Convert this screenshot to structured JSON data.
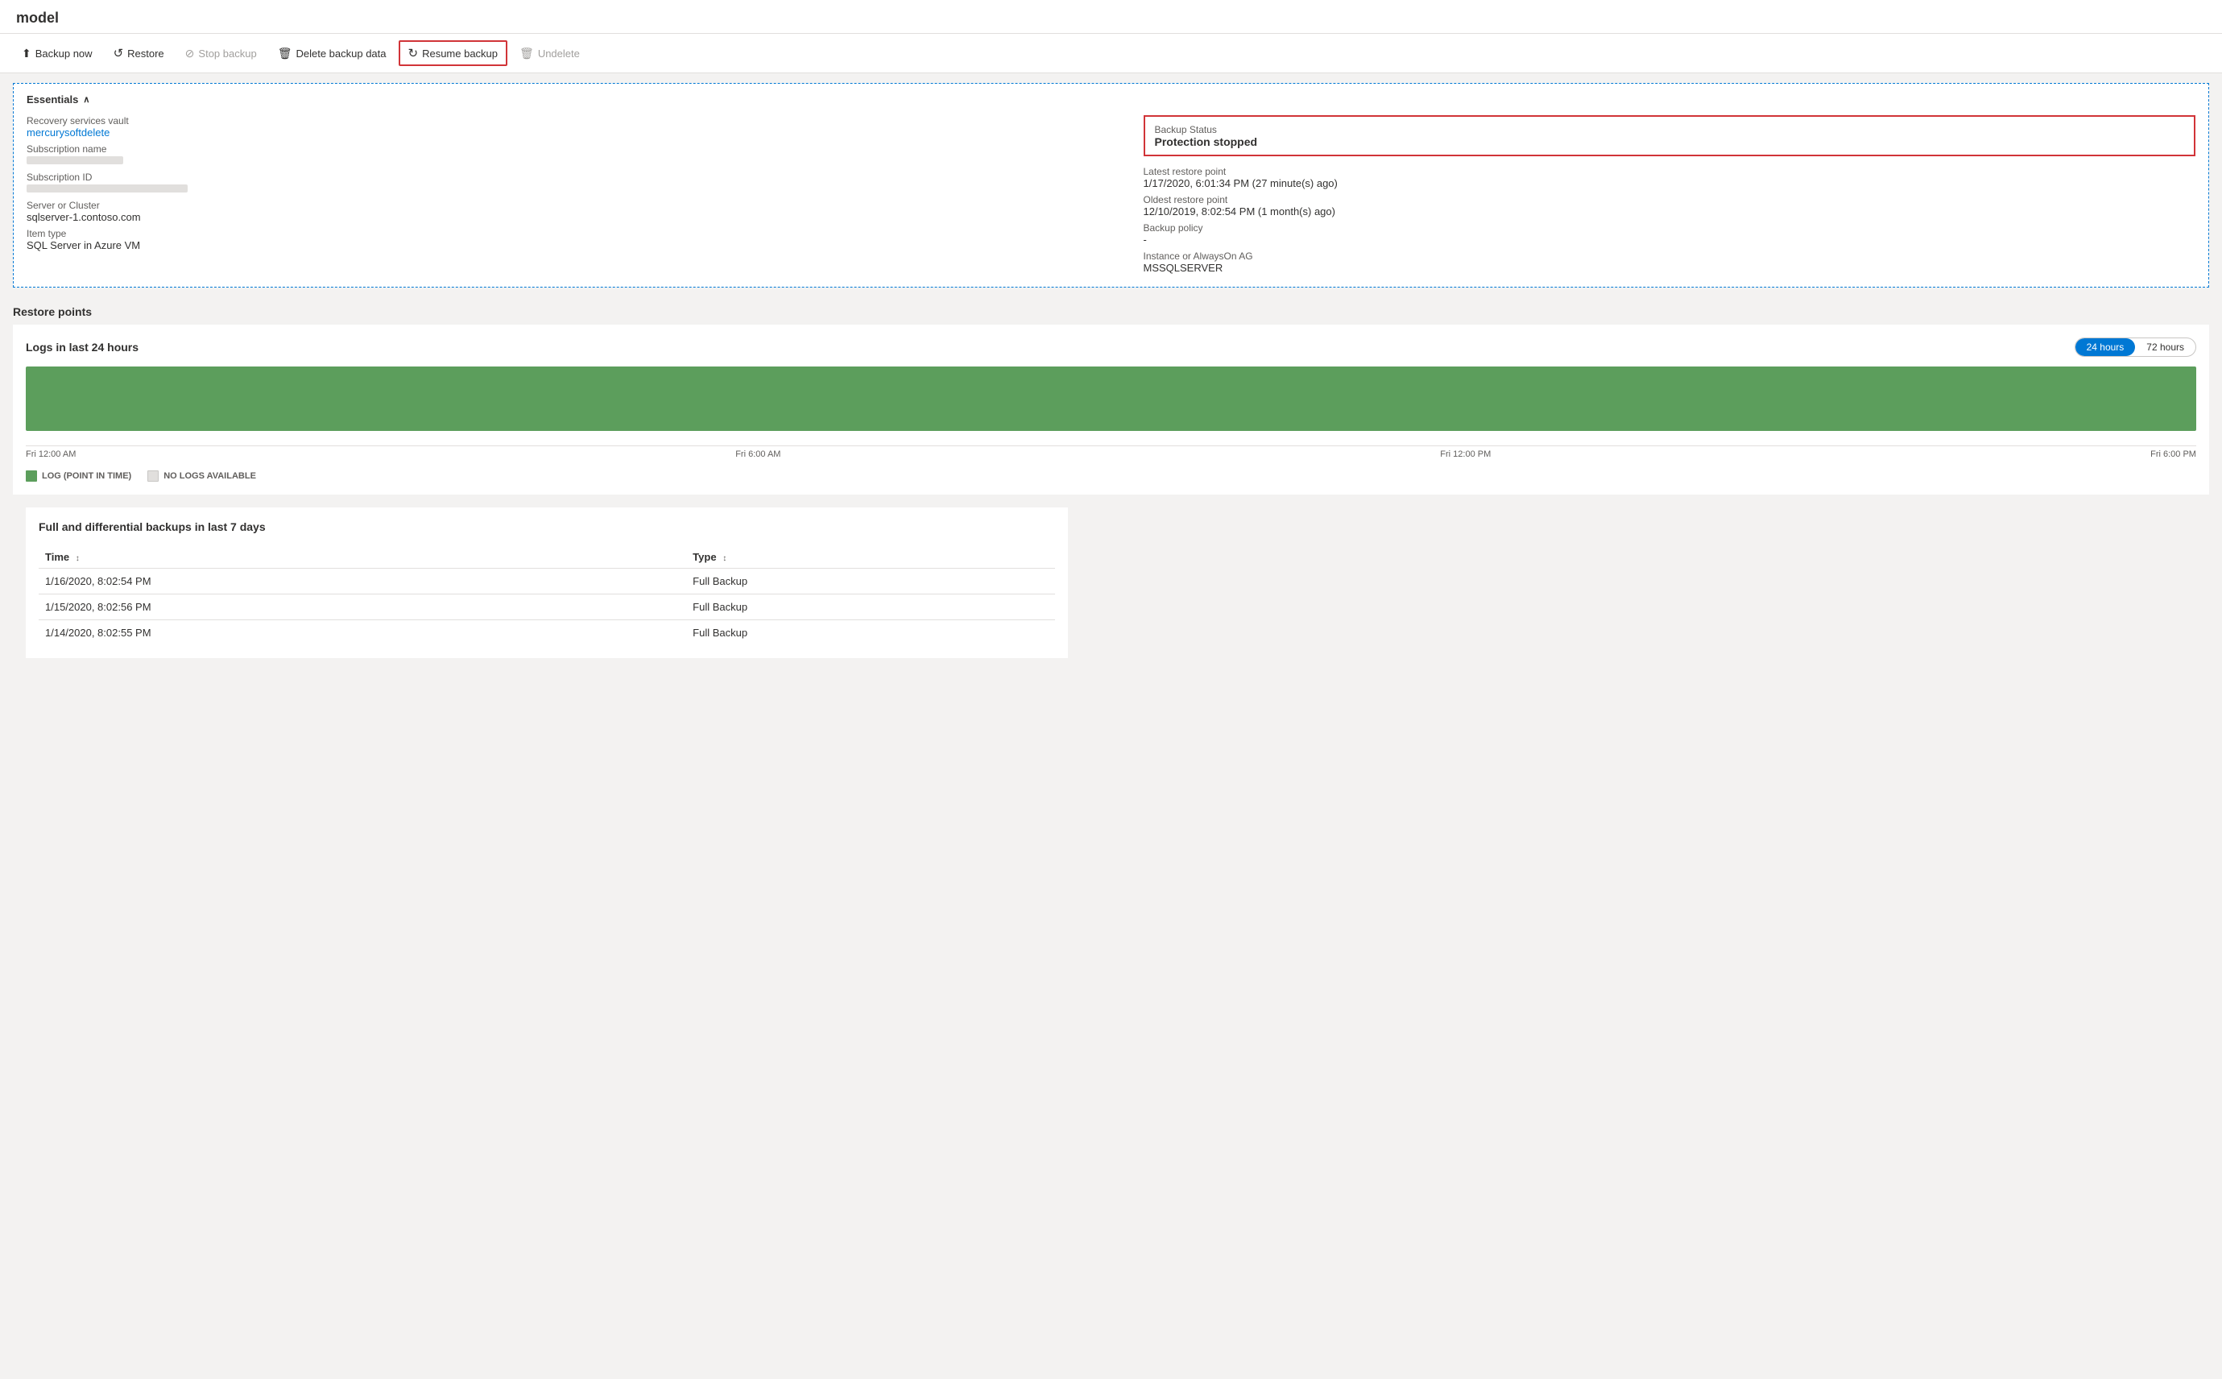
{
  "page": {
    "title": "model"
  },
  "toolbar": {
    "buttons": [
      {
        "id": "backup-now",
        "label": "Backup now",
        "icon": "⬆",
        "disabled": false,
        "highlighted": false
      },
      {
        "id": "restore",
        "label": "Restore",
        "icon": "↺",
        "disabled": false,
        "highlighted": false
      },
      {
        "id": "stop-backup",
        "label": "Stop backup",
        "icon": "⊘",
        "disabled": true,
        "highlighted": false
      },
      {
        "id": "delete-backup-data",
        "label": "Delete backup data",
        "icon": "🗑",
        "disabled": false,
        "highlighted": false
      },
      {
        "id": "resume-backup",
        "label": "Resume backup",
        "icon": "↻",
        "disabled": false,
        "highlighted": true
      },
      {
        "id": "undelete",
        "label": "Undelete",
        "icon": "🗑",
        "disabled": true,
        "highlighted": false
      }
    ]
  },
  "essentials": {
    "header": "Essentials",
    "fields_left": [
      {
        "id": "recovery-vault",
        "label": "Recovery services vault",
        "value": "mercurysoftdelete",
        "is_link": true
      },
      {
        "id": "subscription-name",
        "label": "Subscription name",
        "value": ""
      },
      {
        "id": "subscription-id",
        "label": "Subscription ID",
        "value": ""
      },
      {
        "id": "server-cluster",
        "label": "Server or Cluster",
        "value": "sqlserver-1.contoso.com"
      },
      {
        "id": "item-type",
        "label": "Item type",
        "value": "SQL Server in Azure VM"
      }
    ],
    "fields_right": [
      {
        "id": "backup-status-label",
        "label": "Backup Status",
        "value": "Protection stopped",
        "highlighted": true
      },
      {
        "id": "latest-restore-label",
        "label": "Latest restore point",
        "value": ""
      },
      {
        "id": "latest-restore-value",
        "label": "",
        "value": "1/17/2020, 6:01:34 PM (27 minute(s) ago)"
      },
      {
        "id": "oldest-restore-label",
        "label": "Oldest restore point",
        "value": ""
      },
      {
        "id": "oldest-restore-value",
        "label": "",
        "value": "12/10/2019, 8:02:54 PM (1 month(s) ago)"
      },
      {
        "id": "backup-policy-label",
        "label": "Backup policy",
        "value": ""
      },
      {
        "id": "backup-policy-value",
        "label": "",
        "value": "-"
      },
      {
        "id": "instance-label",
        "label": "Instance or AlwaysOn AG",
        "value": ""
      },
      {
        "id": "instance-value",
        "label": "",
        "value": "MSSQLSERVER"
      }
    ]
  },
  "restore_points": {
    "section_title": "Restore points",
    "chart": {
      "title": "Logs in last 24 hours",
      "time_options": [
        "24 hours",
        "72 hours"
      ],
      "active_option": "24 hours",
      "x_axis_labels": [
        "Fri 12:00 AM",
        "Fri 6:00 AM",
        "Fri 12:00 PM",
        "Fri 6:00 PM"
      ],
      "legend": [
        {
          "id": "log-pit",
          "label": "LOG (POINT IN TIME)",
          "color": "#5c9e5c"
        },
        {
          "id": "no-logs",
          "label": "NO LOGS AVAILABLE",
          "color": "#e1dfdd"
        }
      ]
    },
    "table": {
      "title": "Full and differential backups in last 7 days",
      "columns": [
        {
          "id": "time",
          "label": "Time",
          "sortable": true
        },
        {
          "id": "type",
          "label": "Type",
          "sortable": true
        }
      ],
      "rows": [
        {
          "time": "1/16/2020, 8:02:54 PM",
          "type": "Full Backup"
        },
        {
          "time": "1/15/2020, 8:02:56 PM",
          "type": "Full Backup"
        },
        {
          "time": "1/14/2020, 8:02:55 PM",
          "type": "Full Backup"
        }
      ]
    }
  }
}
